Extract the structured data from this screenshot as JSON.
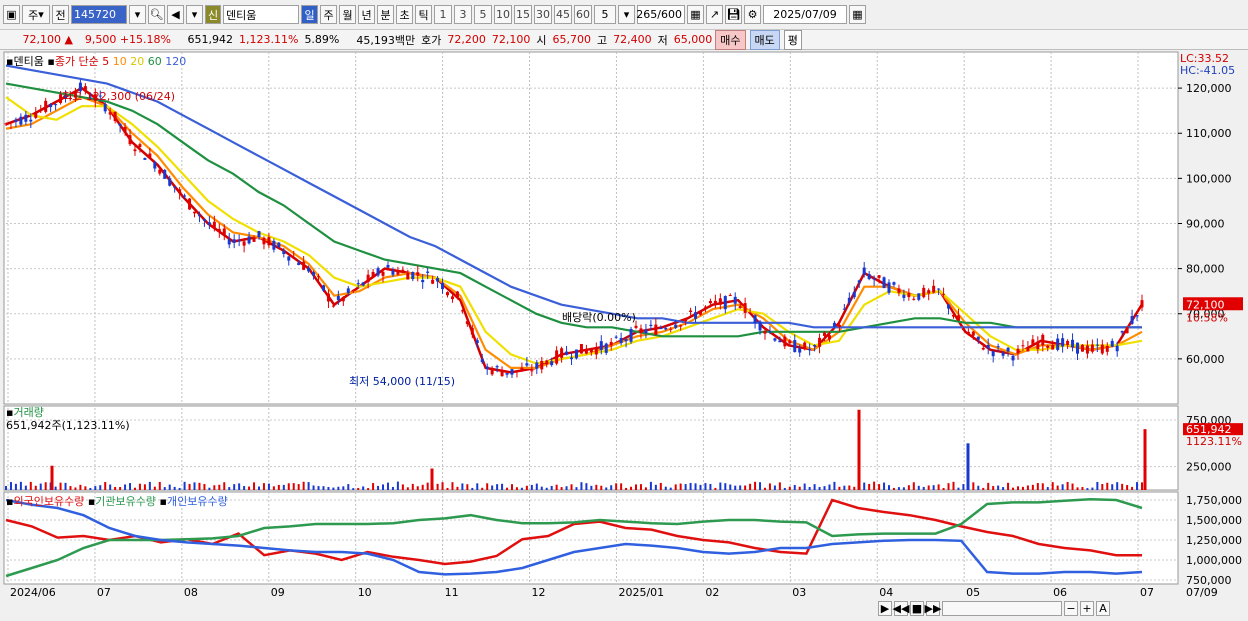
{
  "toolbar": {
    "mode_select": "주",
    "prev_label": "전",
    "stock_code": "145720",
    "credit_badge": "신",
    "stock_name": "덴티움",
    "periods": [
      "일",
      "주",
      "월",
      "년",
      "분",
      "초",
      "틱"
    ],
    "active_period": "일",
    "minute_values": [
      "1",
      "3",
      "5",
      "10",
      "15",
      "30",
      "45",
      "60"
    ],
    "step_value": "5",
    "page_count": "265",
    "page_total": "/600",
    "date": "2025/07/09"
  },
  "infobar": {
    "price": "72,100",
    "change": "9,500",
    "change_rate": "+15.18%",
    "volume": "651,942",
    "volume_ratio": "1,123.11%",
    "turnover": "5.89%",
    "amount": "45,193백만",
    "bid_label": "호가",
    "bid1": "72,200",
    "bid2": "72,100",
    "open_label": "시",
    "open": "65,700",
    "high_label": "고",
    "high": "72,400",
    "low_label": "저",
    "low": "65,000",
    "buy_label": "매수",
    "sell_label": "매도",
    "eval_label": "평"
  },
  "price_panel": {
    "stock_label": "덴티움",
    "ma_label": "종가 단순",
    "ma_periods": [
      "5",
      "10",
      "20",
      "60",
      "120"
    ],
    "lc": "LC:33.52",
    "hc": "HC:-41.05",
    "y_ticks": [
      "120,000",
      "110,000",
      "100,000",
      "90,000",
      "80,000",
      "70,000",
      "60,000"
    ],
    "high_annotation": "최고 122,300 (06/24)",
    "low_annotation": "최저 54,000 (11/15)",
    "dividend_annotation": "배당락(0.00%)",
    "last_price_tag": "72,100",
    "last_pct_tag": "10.58%"
  },
  "volume_panel": {
    "title": "거래량",
    "subtitle": "651,942주(1,123.11%)",
    "y_ticks": [
      "750,000",
      "250,000"
    ],
    "last_tag": "651,942",
    "last_pct": "1123.11%"
  },
  "holdings_panel": {
    "series_labels": [
      "외국인보유수량",
      "기관보유수량",
      "개인보유수량"
    ],
    "y_ticks": [
      "1,750,000",
      "1,500,000",
      "1,250,000",
      "1,000,000",
      "750,000"
    ]
  },
  "x_axis": {
    "labels": [
      "2024/06",
      "07",
      "08",
      "09",
      "10",
      "11",
      "12",
      "2025/01",
      "02",
      "03",
      "04",
      "05",
      "06",
      "07"
    ],
    "right_label": "07/09"
  },
  "colors": {
    "ma5": "#d40000",
    "ma10": "#ff8c00",
    "ma20": "#f0e000",
    "ma60": "#1e9040",
    "ma120": "#3a5fd8",
    "up": "#e00000",
    "down": "#1838d0",
    "foreign": "#e01010",
    "institution": "#2e9a50",
    "individual": "#3060e0"
  },
  "chart_data": [
    {
      "type": "candlestick",
      "title": "덴티움",
      "ylim": [
        50000,
        128000
      ],
      "x": [
        "2024/06",
        "07",
        "08",
        "09",
        "10",
        "11",
        "12",
        "2025/01",
        "02",
        "03",
        "04",
        "05",
        "06",
        "07"
      ],
      "series": [
        {
          "name": "종가 단순 5",
          "values": [
            112000,
            114000,
            117000,
            120000,
            116000,
            108000,
            103000,
            96000,
            90000,
            86000,
            87000,
            84000,
            80000,
            72000,
            76000,
            80000,
            79000,
            78000,
            73000,
            58000,
            57000,
            58000,
            61000,
            62000,
            63000,
            66000,
            67000,
            69000,
            72000,
            73000,
            67000,
            63000,
            62000,
            68000,
            79000,
            76000,
            74000,
            75000,
            66000,
            62000,
            61000,
            64000,
            63000,
            62000,
            63000,
            72100
          ]
        },
        {
          "name": "종가 단순 10",
          "values": [
            111000,
            112000,
            115000,
            118000,
            116000,
            110000,
            105000,
            98000,
            92000,
            88000,
            87000,
            85000,
            81000,
            74000,
            75000,
            78000,
            79000,
            78000,
            74000,
            62000,
            58000,
            58000,
            60000,
            61000,
            63000,
            65000,
            66000,
            68000,
            71000,
            72000,
            69000,
            64000,
            62000,
            66000,
            76000,
            76000,
            74000,
            75000,
            68000,
            63000,
            61000,
            63000,
            63000,
            62000,
            63000,
            66000
          ]
        },
        {
          "name": "종가 단순 20",
          "values": [
            118000,
            114000,
            113000,
            116000,
            116000,
            112000,
            107000,
            101000,
            95000,
            91000,
            88000,
            86000,
            83000,
            78000,
            76000,
            77000,
            78000,
            78000,
            76000,
            66000,
            61000,
            59000,
            60000,
            61000,
            62000,
            64000,
            65000,
            67000,
            69000,
            71000,
            70000,
            66000,
            63000,
            64000,
            72000,
            75000,
            74000,
            75000,
            70000,
            65000,
            62000,
            62000,
            63000,
            63000,
            63000,
            64000
          ]
        },
        {
          "name": "종가 단순 60",
          "values": [
            121000,
            120000,
            119000,
            118000,
            117000,
            115000,
            112000,
            108000,
            104000,
            101000,
            97000,
            94000,
            90000,
            86000,
            84000,
            82000,
            81000,
            80000,
            79000,
            76000,
            73000,
            70000,
            68000,
            67000,
            67000,
            66000,
            65000,
            65000,
            65000,
            65000,
            66000,
            66000,
            66000,
            66000,
            67000,
            68000,
            69000,
            69000,
            68000,
            68000,
            67000,
            67000,
            67000,
            67000,
            67000,
            67000
          ]
        },
        {
          "name": "종가 단순 120",
          "values": [
            125000,
            124000,
            123000,
            122000,
            121000,
            119000,
            117000,
            114000,
            111000,
            108000,
            105000,
            102000,
            99000,
            96000,
            93000,
            90000,
            87000,
            85000,
            82000,
            79000,
            76000,
            74000,
            72000,
            71000,
            70000,
            69000,
            69000,
            68000,
            68000,
            68000,
            68000,
            68000,
            67000,
            67000,
            67000,
            67000,
            67000,
            67000,
            67000,
            67000,
            67000,
            67000,
            67000,
            67000,
            67000,
            67000
          ]
        }
      ],
      "annotations": [
        {
          "text": "최고 122,300 (06/24)",
          "x": "06/24",
          "y": 122300
        },
        {
          "text": "최저 54,000 (11/15)",
          "x": "11/15",
          "y": 54000
        },
        {
          "text": "배당락(0.00%)",
          "x": "2024/12",
          "y": 66000
        }
      ]
    },
    {
      "type": "bar",
      "title": "거래량",
      "ylim": [
        0,
        900000
      ],
      "spikes": [
        {
          "x": "2024/06",
          "value": 260000
        },
        {
          "x": "2024/11",
          "value": 230000
        },
        {
          "x": "2025/04",
          "value": 860000
        },
        {
          "x": "2025/05",
          "value": 500000
        },
        {
          "x": "07/09",
          "value": 651942
        }
      ]
    },
    {
      "type": "line",
      "ylim": [
        700000,
        1850000
      ],
      "series": [
        {
          "name": "외국인보유수량",
          "values": [
            1500000,
            1420000,
            1280000,
            1300000,
            1250000,
            1300000,
            1220000,
            1260000,
            1200000,
            1330000,
            1060000,
            1120000,
            1080000,
            1000000,
            1100000,
            1040000,
            1000000,
            950000,
            980000,
            1050000,
            1260000,
            1300000,
            1450000,
            1480000,
            1400000,
            1380000,
            1300000,
            1250000,
            1220000,
            1150000,
            1100000,
            1080000,
            1750000,
            1650000,
            1600000,
            1560000,
            1500000,
            1420000,
            1350000,
            1300000,
            1200000,
            1150000,
            1120000,
            1060000,
            1060000
          ]
        },
        {
          "name": "기관보유수량",
          "values": [
            800000,
            900000,
            1000000,
            1150000,
            1250000,
            1250000,
            1250000,
            1260000,
            1270000,
            1300000,
            1400000,
            1420000,
            1450000,
            1450000,
            1450000,
            1460000,
            1500000,
            1520000,
            1560000,
            1500000,
            1460000,
            1460000,
            1470000,
            1500000,
            1480000,
            1460000,
            1450000,
            1480000,
            1500000,
            1500000,
            1480000,
            1470000,
            1300000,
            1320000,
            1330000,
            1330000,
            1330000,
            1450000,
            1700000,
            1720000,
            1720000,
            1740000,
            1760000,
            1750000,
            1650000
          ]
        },
        {
          "name": "개인보유수량",
          "values": [
            1750000,
            1690000,
            1650000,
            1560000,
            1400000,
            1300000,
            1250000,
            1220000,
            1200000,
            1180000,
            1150000,
            1120000,
            1100000,
            1100000,
            1080000,
            1000000,
            850000,
            820000,
            830000,
            850000,
            900000,
            1000000,
            1100000,
            1150000,
            1200000,
            1180000,
            1150000,
            1100000,
            1080000,
            1100000,
            1150000,
            1150000,
            1200000,
            1220000,
            1240000,
            1250000,
            1250000,
            1240000,
            850000,
            830000,
            830000,
            850000,
            850000,
            830000,
            850000
          ]
        }
      ]
    }
  ]
}
